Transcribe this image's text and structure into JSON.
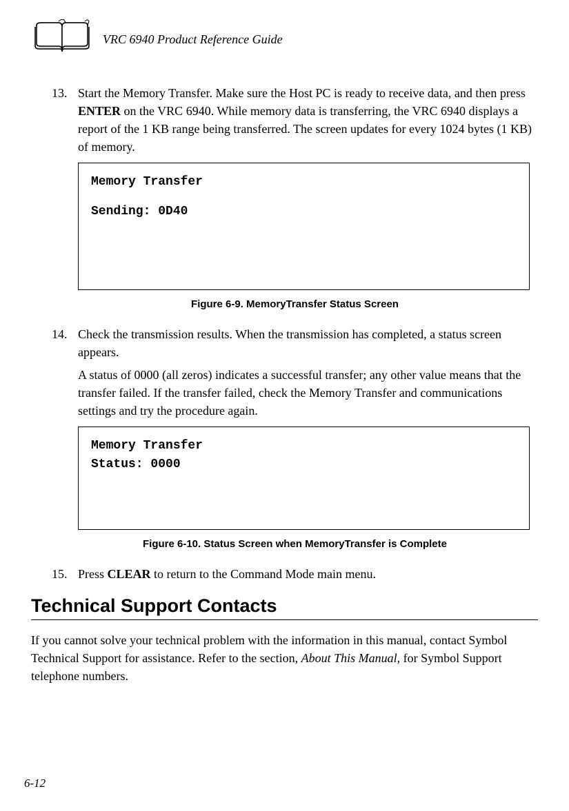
{
  "header": {
    "title": "VRC 6940 Product Reference Guide"
  },
  "items": {
    "item13": {
      "number": "13.",
      "text_pre": "Start the Memory Transfer. Make sure the Host PC is ready to receive data, and then press ",
      "key": "ENTER",
      "text_post": " on the VRC 6940. While memory data is transferring, the VRC 6940 displays a report of the 1 KB range being transferred. The screen updates for every 1024 bytes (1 KB) of memory."
    },
    "item14": {
      "number": "14.",
      "text": "Check the transmission results. When the transmission has completed, a status screen appears.",
      "sub": "A status of 0000 (all zeros) indicates a successful transfer; any other value means that the transfer failed. If the transfer failed, check the Memory Transfer and communications settings and try the procedure again."
    },
    "item15": {
      "number": "15.",
      "text_pre": "Press ",
      "key": "CLEAR",
      "text_post": " to return to the Command Mode main menu."
    }
  },
  "screens": {
    "screen1": {
      "line1": "Memory Transfer",
      "line2": "Sending: 0D40"
    },
    "screen2": {
      "line1": "Memory Transfer",
      "line2": "Status: 0000"
    }
  },
  "figures": {
    "fig1": "Figure 6-9.  MemoryTransfer Status Screen",
    "fig2": "Figure 6-10.  Status Screen when MemoryTransfer is Complete"
  },
  "section": {
    "heading": "Technical Support Contacts",
    "body_pre": "If you cannot solve your technical problem with the information in this manual, contact Symbol Technical Support for assistance. Refer to the section, ",
    "body_italic": "About This Manual,",
    "body_post": " for Symbol Support telephone numbers."
  },
  "page_number": "6-12"
}
